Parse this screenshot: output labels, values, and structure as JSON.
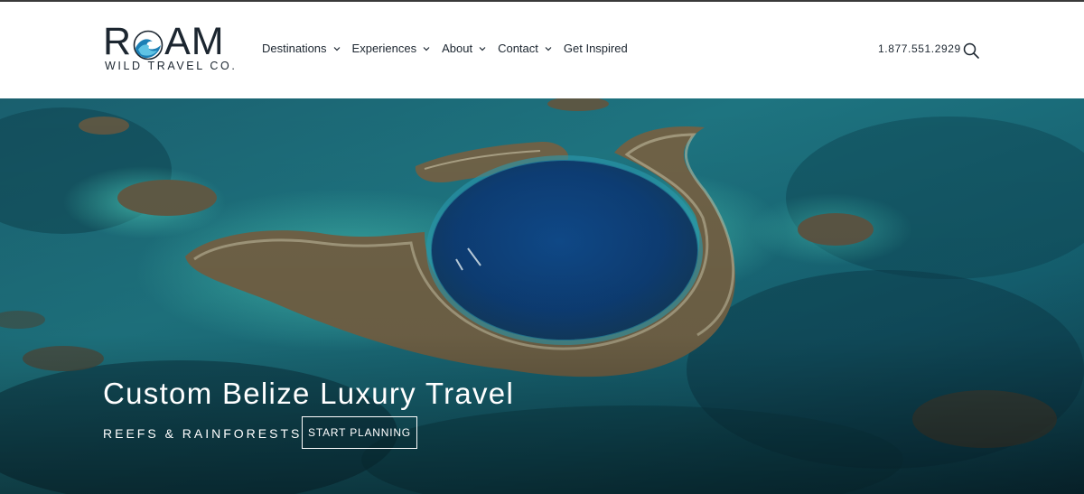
{
  "brand": {
    "name": "ROAM",
    "tagline": "WILD TRAVEL CO."
  },
  "nav": {
    "items": [
      {
        "label": "Destinations",
        "has_dropdown": true
      },
      {
        "label": "Experiences",
        "has_dropdown": true
      },
      {
        "label": "About",
        "has_dropdown": true
      },
      {
        "label": "Contact",
        "has_dropdown": true
      },
      {
        "label": "Get Inspired",
        "has_dropdown": false
      }
    ]
  },
  "header": {
    "phone": "1.877.551.2929",
    "search_icon": "search-icon"
  },
  "hero": {
    "title": "Custom Belize Luxury Travel",
    "subtitle": "REEFS & RAINFORESTS",
    "cta_label": "START PLANNING",
    "image": "aerial view of a blue hole surrounded by coral reef"
  },
  "colors": {
    "text_dark": "#1c2630",
    "hero_text": "#ffffff",
    "ocean_deep": "#0a3140",
    "ocean_teal": "#1f7f8a",
    "blue_hole": "#0d3f7a"
  }
}
